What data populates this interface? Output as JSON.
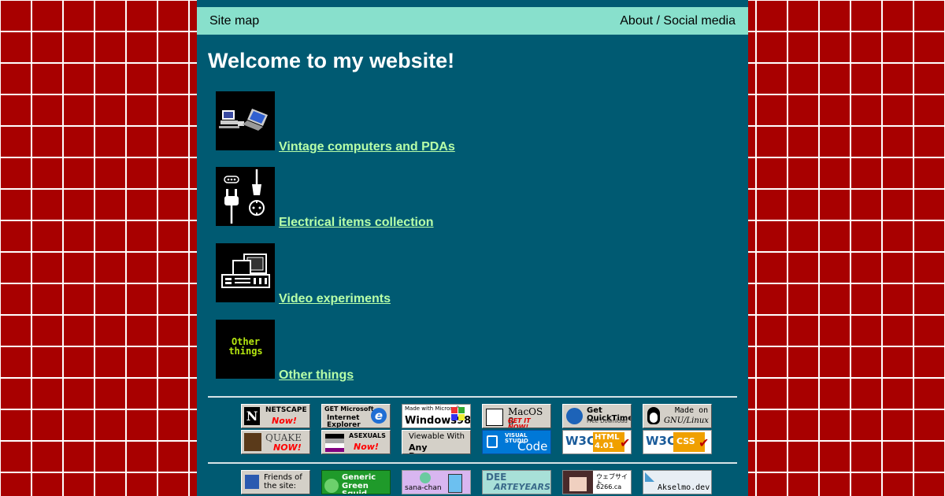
{
  "nav": {
    "left": "Site map",
    "right": "About / Social media"
  },
  "title": "Welcome to my website!",
  "links": [
    {
      "label": "Vintage computers and PDAs",
      "icon": "computers-icon"
    },
    {
      "label": "Electrical items collection",
      "icon": "plug-icon"
    },
    {
      "label": "Video experiments",
      "icon": "video-mixer-icon"
    },
    {
      "label": "Other things",
      "icon": "other-things-icon",
      "icon_text": "Other things"
    }
  ],
  "badges_row1": [
    {
      "line1": "NETSCAPE",
      "line2": "Now!"
    },
    {
      "line1": "GET Microsoft",
      "line2": "Internet Explorer"
    },
    {
      "line1": "Made with Microsoft",
      "line2": "Windows98"
    },
    {
      "line1": "MacOS 8",
      "line2": "GET IT NOW!"
    },
    {
      "line1": "Get QuickTime",
      "line2": "Free Download"
    },
    {
      "line1": "Made on",
      "line2": "GNU/Linux"
    }
  ],
  "badges_row2": [
    {
      "line1": "QUAKE",
      "line2": "NOW!"
    },
    {
      "line1": "ASEXUALS",
      "line2": "Now!"
    },
    {
      "line1": "Viewable With",
      "line2": "Any Browser"
    },
    {
      "line1": "VISUAL STUDIO",
      "line2": "Code"
    },
    {
      "line1": "W3C",
      "line2": "HTML 4.01"
    },
    {
      "line1": "W3C",
      "line2": "CSS"
    }
  ],
  "badges_row3": [
    {
      "line1": "Friends of",
      "line2": "the site:"
    },
    {
      "line1": "Generic",
      "line2": "Green Squid"
    },
    {
      "line1": "sana-chan",
      "line2": ""
    },
    {
      "line1": "DEE",
      "line2": "ARTEYEARS"
    },
    {
      "line1": "ウェブサイト",
      "line2": "6266.ca"
    },
    {
      "line1": "Akselmo.dev",
      "line2": ""
    }
  ],
  "colors": {
    "link": "#b8ffa8",
    "page_bg": "#005a72",
    "nav_bg": "#88e0cc",
    "grid_bg": "#a80000"
  }
}
